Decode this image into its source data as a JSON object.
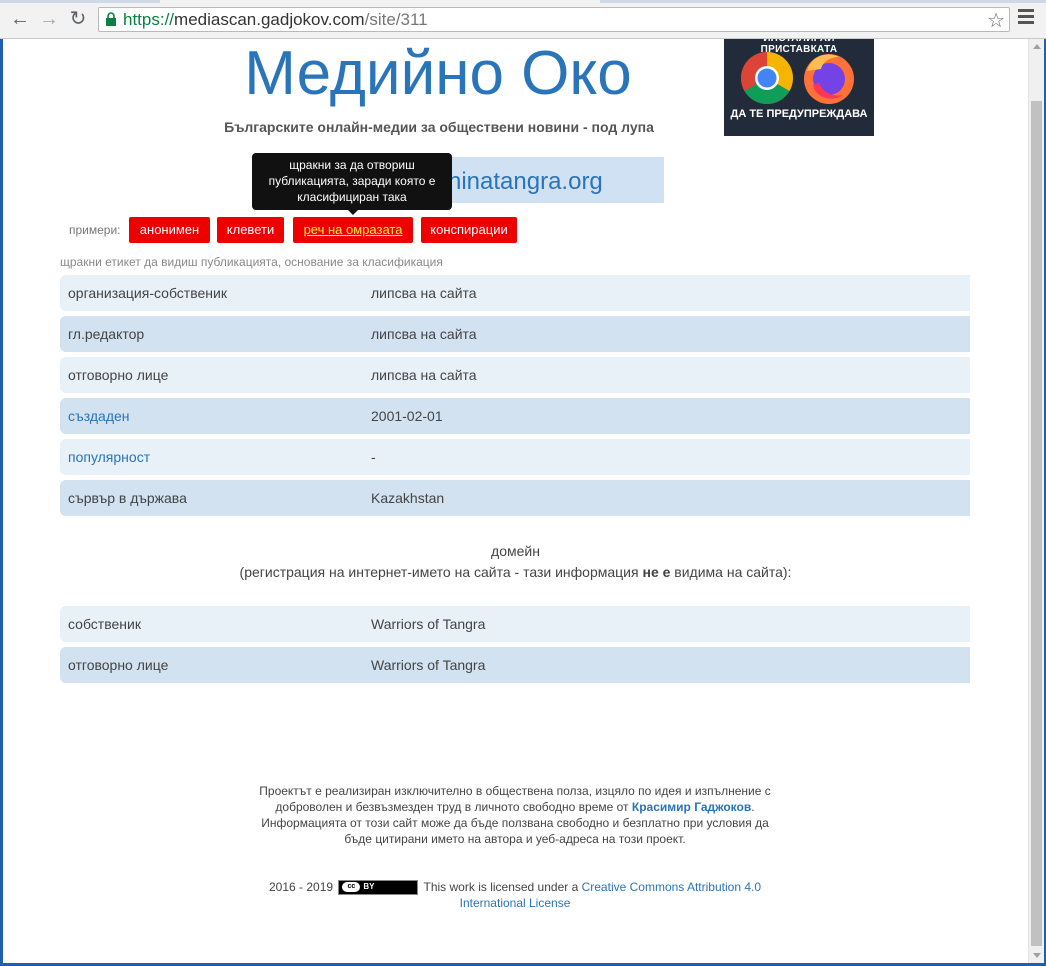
{
  "browser": {
    "url_scheme": "https://",
    "url_host": "mediascan.gadjokov.com",
    "url_path": "/site/311"
  },
  "header": {
    "title": "Медийно Око",
    "tagline": "Българските онлайн-медии за обществени новини - под лупа",
    "extension_banner_top": "ИНСТАЛИРАЙ ПРИСТАВКАТА",
    "extension_banner_bottom": "ДА ТЕ ПРЕДУПРЕЖДАВА"
  },
  "site": {
    "domain_visible": "ninatangra.org"
  },
  "tooltip": "щракни за да отвориш публикацията, заради която е класифициран така",
  "examples": {
    "label": "примери:",
    "tags": [
      "анонимен",
      "клевети",
      "реч на омразата",
      "конспирации"
    ],
    "hint": "щракни етикет да видиш публикацията, основание за класификация"
  },
  "info_rows": [
    {
      "key": "организация-собственик",
      "value": "липсва на сайта"
    },
    {
      "key": "гл.редактор",
      "value": "липсва на сайта"
    },
    {
      "key": "отговорно лице",
      "value": "липсва на сайта"
    },
    {
      "key": "създаден",
      "value": "2001-02-01"
    },
    {
      "key": "популярност",
      "value": "-"
    },
    {
      "key": "сървър в държава",
      "value": "Kazakhstan"
    }
  ],
  "domain_section": {
    "heading": "домейн",
    "note_before": "(регистрация на интернет-името на сайта - тази информация",
    "note_bold": "не е",
    "note_after": "видима на сайта):"
  },
  "domain_rows": [
    {
      "key": "собственик",
      "value": "Warriors of Tangra"
    },
    {
      "key": "отговорно лице",
      "value": "Warriors of Tangra"
    }
  ],
  "footer": {
    "line1": "Проектът е реализиран изключително в обществена полза, изцяло по идея и изпълнение с доброволен и безвъзмезден труд в личното свободно време от",
    "author": "Красимир Гаджоков",
    "line2": "Информацията от този сайт може да бъде ползвана свободно и безплатно при условия да бъде цитирани името на автора и уеб-адреса на този проект.",
    "years": "2016 - 2019",
    "cc_mark": "cc",
    "by_mark": "BY",
    "license_text": "This work is licensed under a",
    "license_link": "Creative Commons Attribution 4.0 International License"
  }
}
